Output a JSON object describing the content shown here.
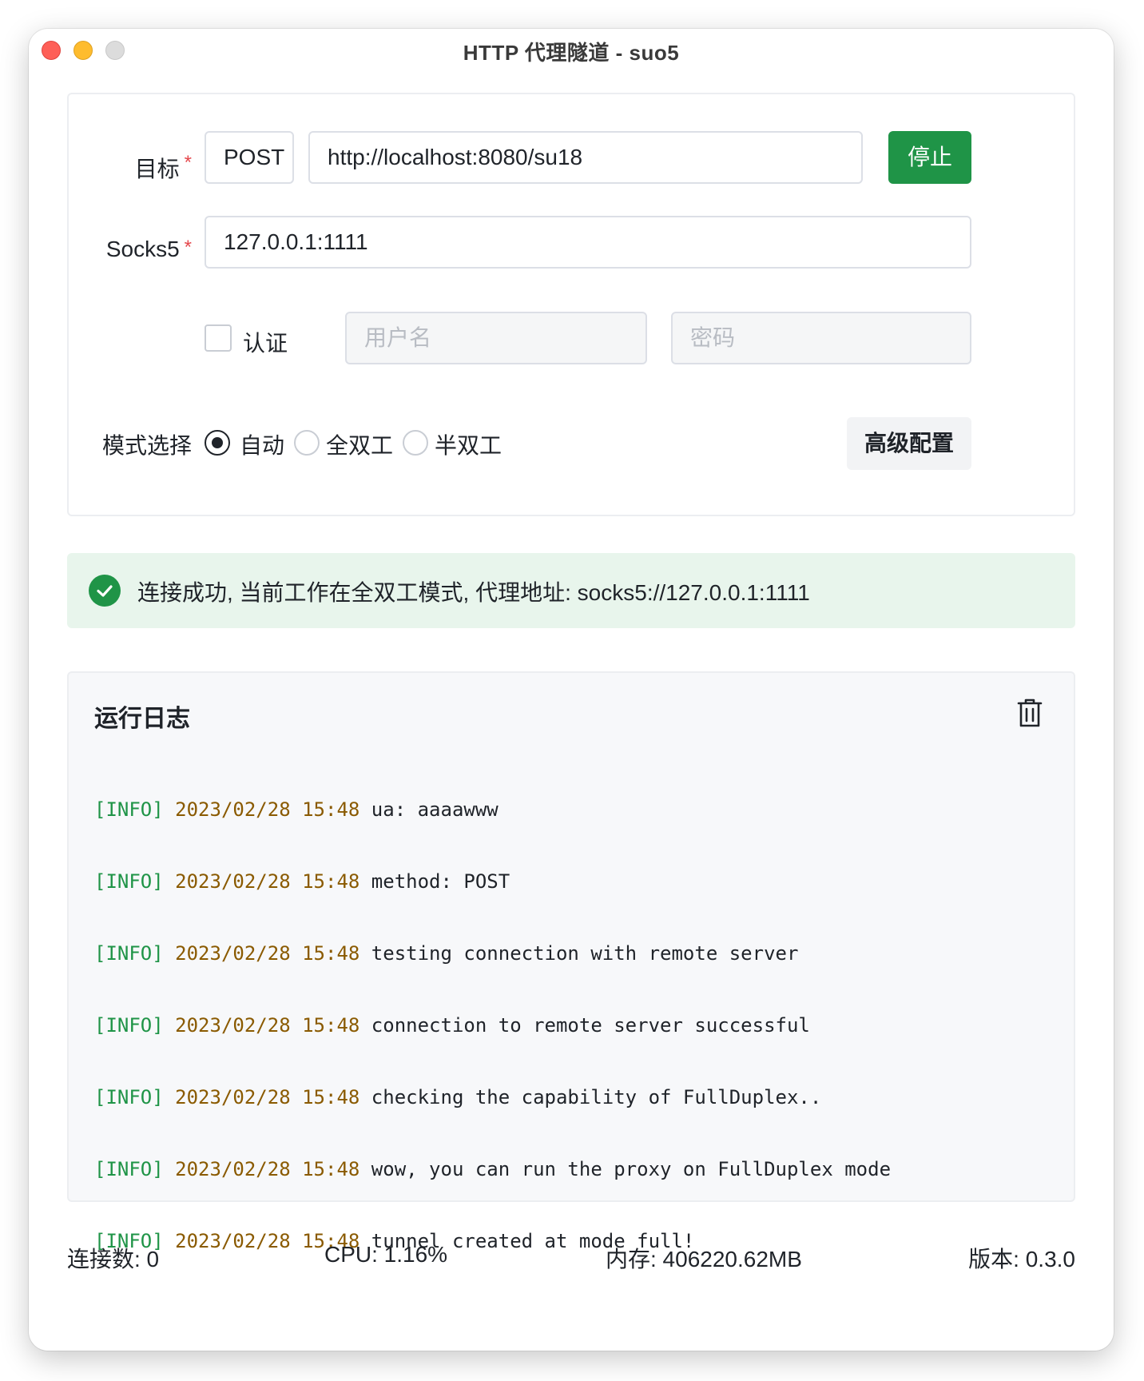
{
  "window": {
    "title": "HTTP 代理隧道 - suo5"
  },
  "form": {
    "target_label": "目标",
    "required_mark": "*",
    "method_value": "POST",
    "url_value": "http://localhost:8080/su18",
    "stop_button": "停止",
    "socks5_label": "Socks5",
    "socks5_value": "127.0.0.1:1111",
    "auth_label": "认证",
    "auth_checked": false,
    "username_placeholder": "用户名",
    "password_placeholder": "密码",
    "mode_label": "模式选择",
    "modes": [
      {
        "label": "自动",
        "checked": true
      },
      {
        "label": "全双工",
        "checked": false
      },
      {
        "label": "半双工",
        "checked": false
      }
    ],
    "advanced_button": "高级配置"
  },
  "alert": {
    "type": "success",
    "text": "连接成功, 当前工作在全双工模式, 代理地址: socks5://127.0.0.1:1111"
  },
  "log": {
    "title": "运行日志",
    "lines": [
      {
        "level": "[INFO]",
        "time": "2023/02/28 15:48",
        "message": "ua: aaaawww"
      },
      {
        "level": "[INFO]",
        "time": "2023/02/28 15:48",
        "message": "method: POST"
      },
      {
        "level": "[INFO]",
        "time": "2023/02/28 15:48",
        "message": "testing connection with remote server"
      },
      {
        "level": "[INFO]",
        "time": "2023/02/28 15:48",
        "message": "connection to remote server successful"
      },
      {
        "level": "[INFO]",
        "time": "2023/02/28 15:48",
        "message": "checking the capability of FullDuplex.."
      },
      {
        "level": "[INFO]",
        "time": "2023/02/28 15:48",
        "message": "wow, you can run the proxy on FullDuplex mode"
      },
      {
        "level": "[INFO]",
        "time": "2023/02/28 15:48",
        "message": "tunnel created at mode full!"
      }
    ]
  },
  "status": {
    "connections": "连接数: 0",
    "cpu": "CPU: 1.16%",
    "memory": "内存: 406220.62MB",
    "version": "版本: 0.3.0"
  },
  "colors": {
    "accent": "#1f9447",
    "success_bg": "#e8f5ec",
    "required": "#e5484d",
    "log_time": "#8a5a00"
  },
  "icons": {
    "alert": "check-circle-icon",
    "log_clear": "trash-icon"
  }
}
